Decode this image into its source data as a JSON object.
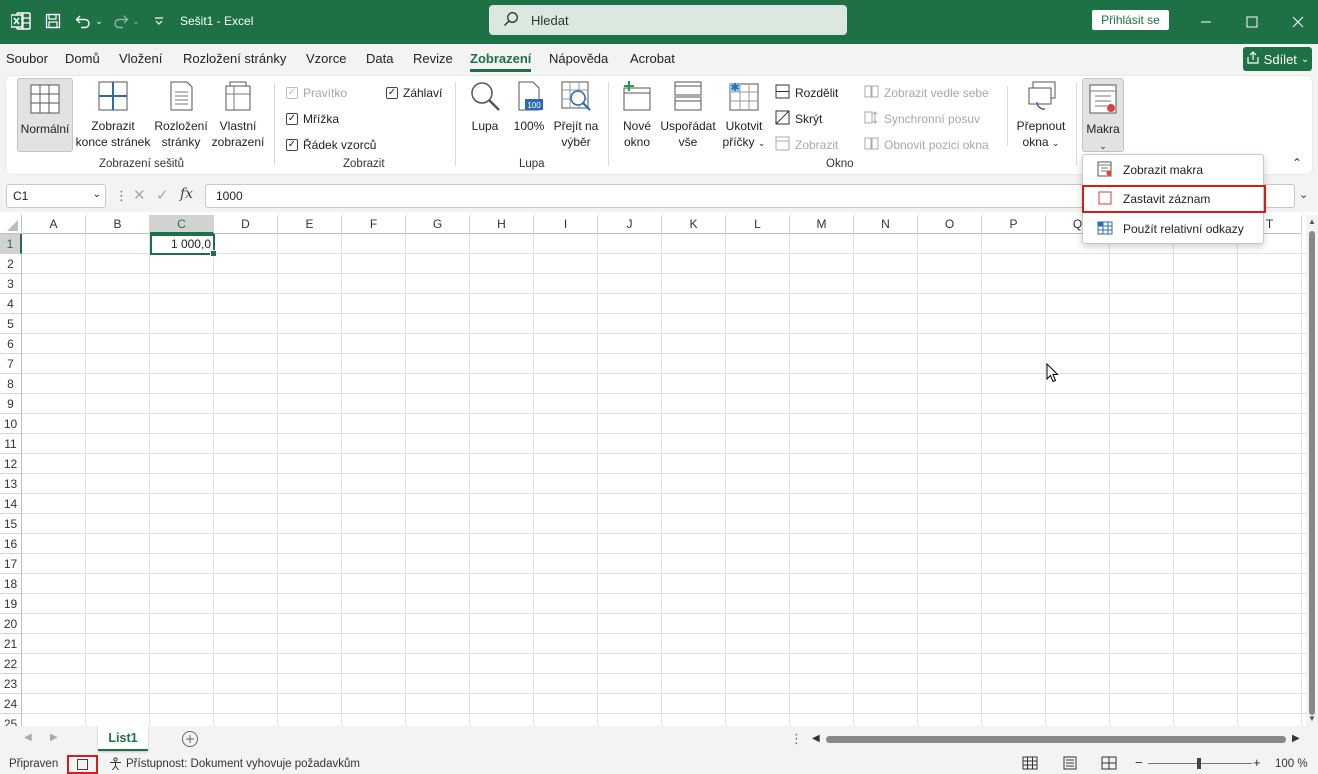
{
  "titlebar": {
    "title": "Sešit1  -  Excel",
    "search_placeholder": "Hledat",
    "signin_label": "Přihlásit se"
  },
  "menu": {
    "tabs": [
      "Soubor",
      "Domů",
      "Vložení",
      "Rozložení stránky",
      "Vzorce",
      "Data",
      "Revize",
      "Zobrazení",
      "Nápověda",
      "Acrobat"
    ],
    "active": "Zobrazení",
    "share_label": "Sdílet"
  },
  "ribbon": {
    "views": {
      "group_name": "Zobrazení sešitů",
      "normal": "Normální",
      "pagebreak_1": "Zobrazit",
      "pagebreak_2": "konce stránek",
      "pagelayout_1": "Rozložení",
      "pagelayout_2": "stránky",
      "custom_1": "Vlastní",
      "custom_2": "zobrazení"
    },
    "show": {
      "group_name": "Zobrazit",
      "ruler": "Pravítko",
      "gridlines": "Mřížka",
      "formula_bar": "Řádek vzorců",
      "headings": "Záhlaví"
    },
    "zoom": {
      "group_name": "Lupa",
      "zoom": "Lupa",
      "zoom100": "100%",
      "zoom100_icon_text": "100",
      "zoomsel_1": "Přejít na",
      "zoomsel_2": "výběr"
    },
    "window": {
      "group_name": "Okno",
      "new_1": "Nové",
      "new_2": "okno",
      "arrange_1": "Uspořádat",
      "arrange_2": "vše",
      "freeze_1": "Ukotvit",
      "freeze_2": "příčky",
      "split": "Rozdělit",
      "hide": "Skrýt",
      "unhide": "Zobrazit",
      "side_by_side": "Zobrazit vedle sebe",
      "sync_scroll": "Synchronní posuv",
      "reset_pos": "Obnovit pozici okna",
      "switch_1": "Přepnout",
      "switch_2": "okna"
    },
    "macros": {
      "label": "Makra"
    }
  },
  "macro_menu": {
    "view": "Zobrazit makra",
    "stop": "Zastavit záznam",
    "relative": "Použít relativní odkazy"
  },
  "formula_bar": {
    "name_box": "C1",
    "fx": "fx",
    "content": "1000"
  },
  "grid": {
    "columns": [
      "A",
      "B",
      "C",
      "D",
      "E",
      "F",
      "G",
      "H",
      "I",
      "J",
      "K",
      "L",
      "M",
      "N",
      "O",
      "P",
      "Q",
      "R",
      "S",
      "T"
    ],
    "rows": [
      "1",
      "2",
      "3",
      "4",
      "5",
      "6",
      "7",
      "8",
      "9",
      "10",
      "11",
      "12",
      "13",
      "14",
      "15",
      "16",
      "17",
      "18",
      "19",
      "20",
      "21",
      "22",
      "23",
      "24",
      "25"
    ],
    "selected_column": "C",
    "selected_row": "1",
    "active_cell_value": "1 000,0"
  },
  "sheets": {
    "active": "List1"
  },
  "status": {
    "ready": "Připraven",
    "accessibility": "Přístupnost: Dokument vyhovuje požadavkům",
    "zoom": "100 %"
  }
}
